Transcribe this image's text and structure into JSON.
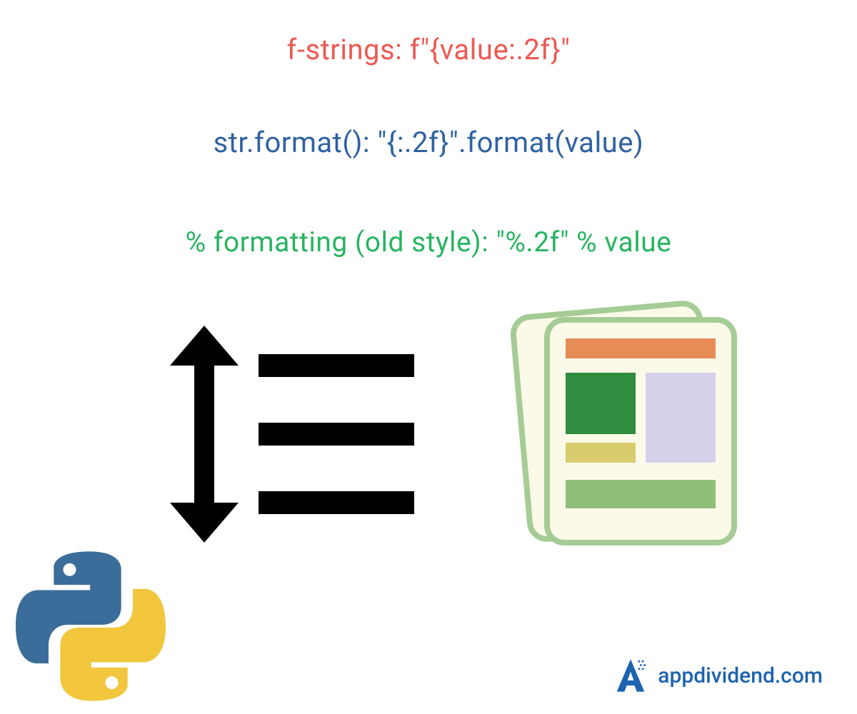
{
  "methods": {
    "fstrings": "f-strings:  f\"{value:.2f}\"",
    "strformat": "str.format():  \"{:.2f}\".format(value)",
    "percent": "% formatting (old style):  \"%.2f\" % value"
  },
  "brand": {
    "text": "appdividend.com"
  },
  "colors": {
    "fstrings": "#ec5a52",
    "strformat": "#2f62a2",
    "percent": "#28b461",
    "brand": "#1e63b0"
  }
}
